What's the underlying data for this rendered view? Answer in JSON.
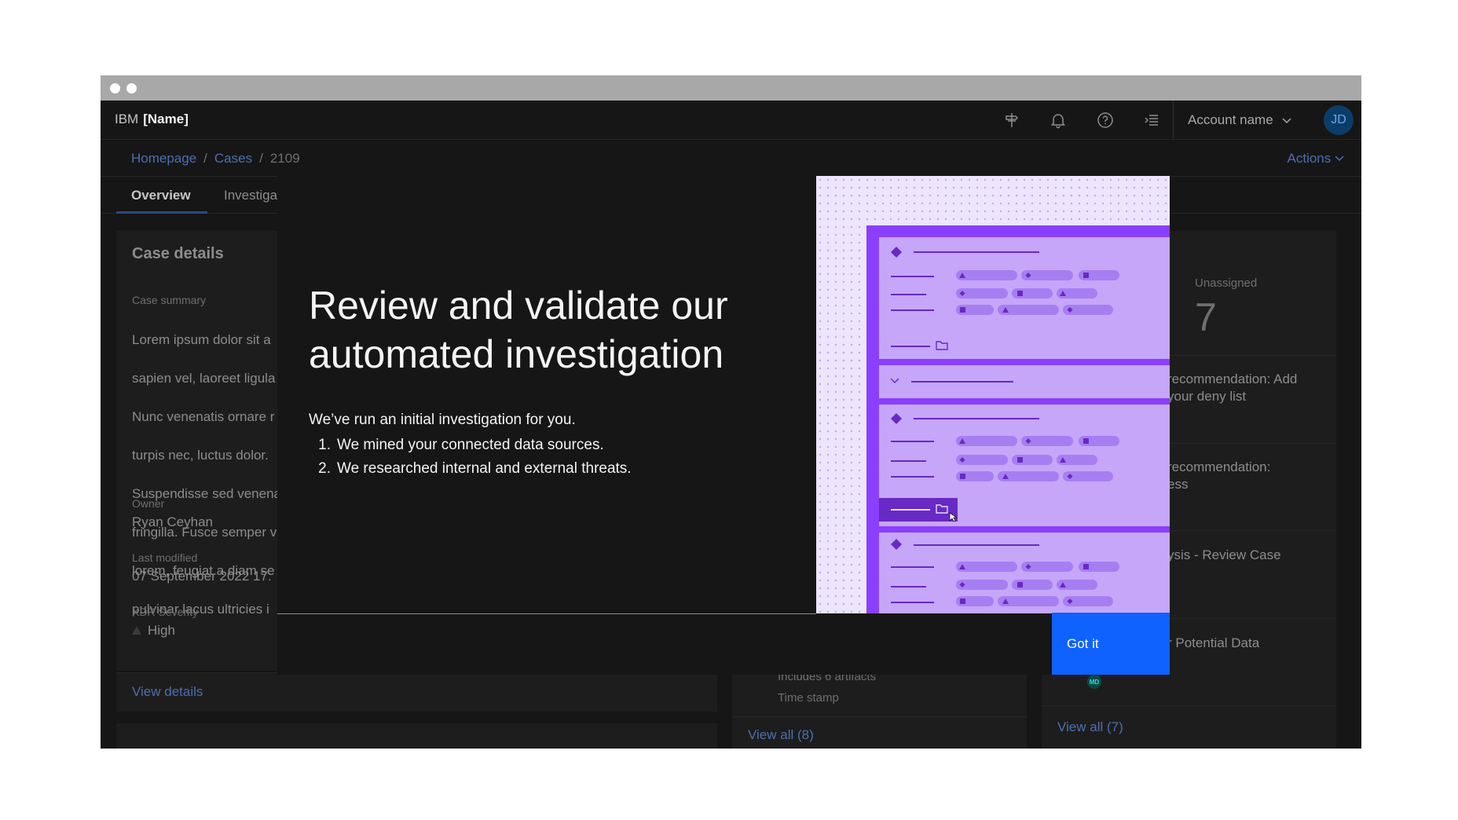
{
  "header": {
    "brand": "IBM",
    "product": "[Name]",
    "account_name": "Account name",
    "avatar_initials": "JD"
  },
  "breadcrumb": {
    "items": [
      "Homepage",
      "Cases",
      "2109"
    ],
    "actions": "Actions"
  },
  "tabs": [
    "Overview",
    "Investiga"
  ],
  "case_details": {
    "title": "Case details",
    "summary_label": "Case summary",
    "summary_lines": [
      "Lorem ipsum dolor sit a",
      "sapien vel, laoreet ligula",
      "Nunc venenatis ornare r",
      "turpis nec, luctus dolor.",
      "Suspendisse sed venena",
      "fringilla. Fusce semper v",
      "lorem, feugiat a diam se",
      "pulvinar lacus ultricies i"
    ],
    "owner_label": "Owner",
    "owner": "Ryan Ceyhan",
    "modified_label": "Last modified",
    "modified": "07 September 2022 17:",
    "severity_label": "XDR Severity",
    "severity": "High",
    "view_details": "View details"
  },
  "middle_card": {
    "partial_text": "Includes 6 artifacts",
    "timestamp": "Time stamp",
    "view_all": "View all (8)"
  },
  "right_card": {
    "unassigned_label": "Unassigned",
    "unassigned_count": "7",
    "rec1": "recommendation: Add your deny list",
    "rec2": "recommendation:",
    "rec2_b": "ess",
    "rec3": "ysis - Review Case",
    "rec4": "r Potential Data",
    "avatar": "MD",
    "view_all": "View all (7)"
  },
  "modal": {
    "title": "Review and validate our automated investigation",
    "intro": "We’ve run an initial investigation for you.",
    "steps": [
      "We mined your connected data sources.",
      "We researched internal and external threats."
    ],
    "primary_button": "Got it"
  },
  "colors": {
    "background": "#161616",
    "primary": "#0f62fe",
    "illustration_bg": "#e0d2fa",
    "illustration_accent": "#8a3ffc"
  }
}
